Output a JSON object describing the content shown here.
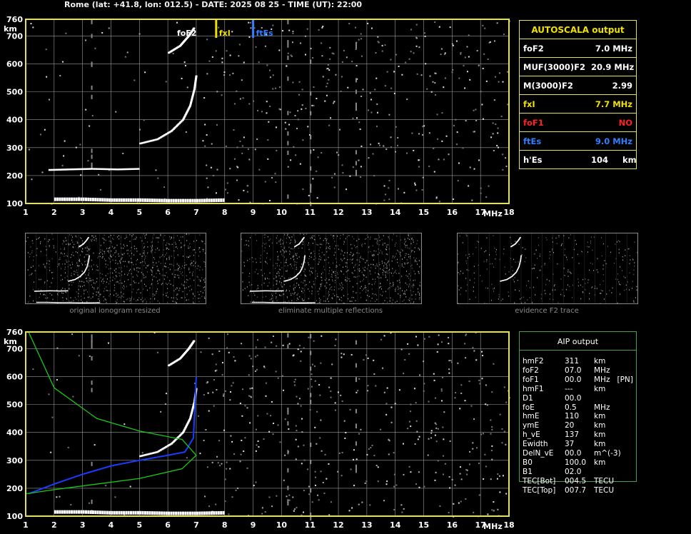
{
  "header": {
    "title": "Rome (lat: +41.8, lon: 012.5) - DATE: 2025 08 25 - TIME (UT): 22:00"
  },
  "colors": {
    "grid": "#9a9a9a",
    "frame": "#e6e060",
    "fxI": "#f0e000",
    "ftEs": "#2f7fff",
    "foF1": "#ff2020",
    "model": "#1a3cff",
    "profile": "#18c818"
  },
  "chart_data": [
    {
      "type": "scatter",
      "title": "",
      "xlabel": "MHz",
      "ylabel": "km",
      "xlim": [
        1,
        18
      ],
      "ylim": [
        100,
        760
      ],
      "x_ticks": [
        "1",
        "2",
        "3",
        "4",
        "5",
        "6",
        "7",
        "8",
        "9",
        "10",
        "11",
        "12",
        "13",
        "14",
        "15",
        "16",
        "17",
        "18"
      ],
      "y_ticks": [
        "100",
        "200",
        "300",
        "400",
        "500",
        "600",
        "700",
        "760"
      ],
      "markers": [
        {
          "label": "foF2",
          "x": 7.0
        },
        {
          "label": "fxI",
          "x": 7.7
        },
        {
          "label": "ftEs",
          "x": 9.0
        }
      ],
      "traces": [
        {
          "name": "F2 O-trace",
          "x": [
            5.0,
            5.6,
            6.1,
            6.5,
            6.75,
            6.9,
            6.97
          ],
          "y": [
            315,
            330,
            360,
            400,
            450,
            510,
            560
          ]
        },
        {
          "name": "F2 second-hop",
          "x": [
            6.0,
            6.4,
            6.7,
            6.9
          ],
          "y": [
            640,
            665,
            700,
            730
          ]
        },
        {
          "name": "Es layer",
          "x": [
            2.0,
            3.0,
            4.0,
            5.0,
            6.0,
            7.0,
            8.0
          ],
          "y": [
            115,
            115,
            112,
            112,
            110,
            110,
            112
          ]
        },
        {
          "name": "Es second hop",
          "x": [
            1.8,
            2.5,
            3.3,
            4.2,
            5.0
          ],
          "y": [
            220,
            222,
            224,
            222,
            224
          ]
        }
      ]
    },
    {
      "type": "line",
      "title": "",
      "xlabel": "MHz",
      "ylabel": "km",
      "xlim": [
        1,
        18
      ],
      "ylim": [
        100,
        760
      ],
      "x_ticks": [
        "1",
        "2",
        "3",
        "4",
        "5",
        "6",
        "7",
        "8",
        "9",
        "10",
        "11",
        "12",
        "13",
        "14",
        "15",
        "16",
        "17",
        "18"
      ],
      "y_ticks": [
        "100",
        "200",
        "300",
        "400",
        "500",
        "600",
        "700",
        "760"
      ],
      "series": [
        {
          "name": "true-height profile",
          "x": [
            1.1,
            2.0,
            3.0,
            4.0,
            5.0,
            6.0,
            6.6,
            6.9,
            7.0
          ],
          "y": [
            180,
            215,
            250,
            280,
            300,
            318,
            330,
            380,
            600
          ]
        },
        {
          "name": "plasma frequency profile",
          "x": [
            1.0,
            2.0,
            3.5,
            5.0,
            6.5,
            7.0,
            6.5,
            5.0,
            3.5,
            2.0,
            1.1
          ],
          "y": [
            180,
            195,
            215,
            235,
            270,
            318,
            375,
            405,
            450,
            560,
            760
          ]
        }
      ],
      "traces": [
        {
          "name": "F2 O-trace",
          "x": [
            5.0,
            5.6,
            6.1,
            6.5,
            6.75,
            6.9,
            6.97
          ],
          "y": [
            315,
            330,
            360,
            400,
            450,
            510,
            560
          ]
        },
        {
          "name": "F2 second-hop",
          "x": [
            6.0,
            6.4,
            6.7,
            6.9
          ],
          "y": [
            640,
            665,
            700,
            730
          ]
        },
        {
          "name": "Es layer",
          "x": [
            2.0,
            3.0,
            4.0,
            5.0,
            6.0,
            7.0,
            8.0
          ],
          "y": [
            115,
            115,
            112,
            112,
            110,
            110,
            112
          ]
        }
      ]
    }
  ],
  "thumbnails": [
    {
      "caption": "original ionogram resized"
    },
    {
      "caption": "eliminate multiple reflections"
    },
    {
      "caption": "evidence F2 trace"
    }
  ],
  "autoscala": {
    "title": "AUTOSCALA output",
    "rows": [
      {
        "name": "foF2",
        "value": "7.0 MHz",
        "color": "#ffffff"
      },
      {
        "name": "MUF(3000)F2",
        "value": "20.9 MHz",
        "color": "#ffffff"
      },
      {
        "name": "M(3000)F2",
        "value": "2.99",
        "color": "#ffffff"
      },
      {
        "name": "fxI",
        "value": "7.7 MHz",
        "color": "#f0e000"
      },
      {
        "name": "foF1",
        "value": "NO",
        "color": "#ff2020"
      },
      {
        "name": "ftEs",
        "value": "9.0 MHz",
        "color": "#2f7fff"
      },
      {
        "name": "h'Es",
        "value": "104     km",
        "color": "#ffffff"
      }
    ]
  },
  "aip": {
    "title": "AIP output",
    "rows": [
      {
        "name": "hmF2",
        "value": "311",
        "unit": "km"
      },
      {
        "name": "foF2",
        "value": "07.0",
        "unit": "MHz"
      },
      {
        "name": "foF1",
        "value": "00.0",
        "unit": "MHz   [PN]"
      },
      {
        "name": "hmF1",
        "value": "---",
        "unit": "km"
      },
      {
        "name": "D1",
        "value": "00.0",
        "unit": ""
      },
      {
        "name": "foE",
        "value": "0.5",
        "unit": "MHz"
      },
      {
        "name": "hmE",
        "value": "110",
        "unit": "km"
      },
      {
        "name": "ymE",
        "value": "20",
        "unit": "km"
      },
      {
        "name": "h_vE",
        "value": "137",
        "unit": "km"
      },
      {
        "name": "Ewidth",
        "value": "37",
        "unit": "km"
      },
      {
        "name": "DelN_vE",
        "value": "00.0",
        "unit": "m^(-3)"
      },
      {
        "name": "B0",
        "value": "100.0",
        "unit": "km"
      },
      {
        "name": "B1",
        "value": "02.0",
        "unit": ""
      },
      {
        "name": "TEC[Bot]",
        "value": "004.5",
        "unit": "TECU"
      },
      {
        "name": "TEC[Top]",
        "value": "007.7",
        "unit": "TECU"
      }
    ]
  }
}
